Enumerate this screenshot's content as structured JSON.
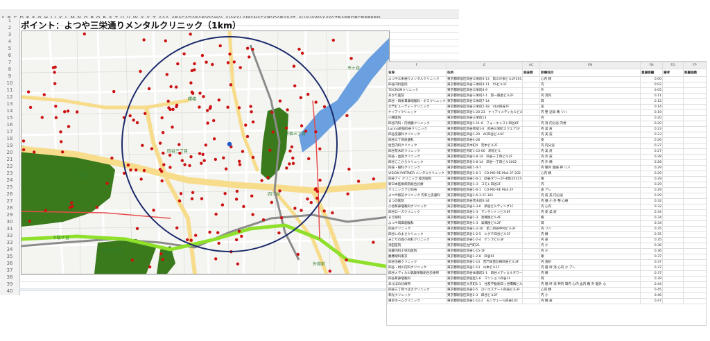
{
  "sheet": {
    "columns": [
      "A",
      "B",
      "C",
      "D",
      "E",
      "F",
      "G",
      "H",
      "I",
      "J",
      "K",
      "L",
      "M",
      "N",
      "O",
      "P",
      "Q",
      "R",
      "S",
      "T",
      "U",
      "V",
      "W",
      "X",
      "Y",
      "Z",
      "AAA",
      "ABACADAEAFAGAHAI",
      "AJAKALAMANACAPAQARASAT",
      "AUAVAWAXAYAZBAEBDBCBEBFBG"
    ],
    "rows": [
      "1",
      "2",
      "3",
      "4",
      "5",
      "6",
      "7",
      "8",
      "9",
      "10",
      "11",
      "12",
      "13",
      "14",
      "15",
      "16",
      "17",
      "18",
      "19",
      "20",
      "21",
      "22",
      "23",
      "24",
      "25",
      "26",
      "27",
      "28",
      "29",
      "30",
      "31",
      "32",
      "33",
      "34",
      "35",
      "36",
      "37",
      "38",
      "39",
      "40"
    ]
  },
  "title": "ポイント：よつや三栄通りメンタルクリニック（1km）",
  "map": {
    "station_labels": [
      "新宿三丁目",
      "四谷三丁目",
      "曙橋",
      "市ヶ谷",
      "四ツ谷",
      "千駄ケ谷",
      "信濃町",
      "国立競技場",
      "外苑前",
      "内藤町"
    ],
    "colors": {
      "park": "#3a7a1c",
      "rail": "#8ee02b",
      "road_major": "#f7dc8c",
      "circle": "#1a2a6b",
      "dot": "#cc1111",
      "water": "#6aa0df"
    }
  },
  "panel": {
    "col_letters": [
      "F",
      "G",
      "AC",
      "FM",
      "FN",
      "FO",
      "FP"
    ],
    "headers": [
      "名称",
      "住所",
      "病床数",
      "診療科目",
      "直線距離",
      "備考",
      "距離指数"
    ],
    "rows": [
      [
        "よつや三栄通りメンタルクリニック",
        "東京都新宿区四谷三栄町4-13　第三冷泉ビル2F201",
        "",
        "心内 精",
        "0.00"
      ],
      [
        "四谷内科医院",
        "東京都新宿区四谷三栄町4-11　YSビル1F",
        "",
        "内",
        "0.02"
      ],
      [
        "TOCROMクリニック",
        "東京都新宿区四谷三栄町4-9",
        "",
        "外",
        "0.05"
      ],
      [
        "あかり医院",
        "東京都新宿区四谷三栄町2-1　第一興産ビル2F",
        "",
        "内 消内",
        "0.11"
      ],
      [
        "四谷・四栄耳鼻咽喉科・ボスクリニック",
        "東京都新宿区四谷三栄町7-14",
        "",
        "耳",
        "0.12"
      ],
      [
        "大門ビューティークリニック",
        "東京都新宿区四谷三栄町2-18　Vbit四谷7F",
        "",
        "美",
        "0.14"
      ],
      [
        "ケイアイクリニック",
        "東京都新宿区四谷1-20-23　ケイアイメディカルビル",
        "",
        "内 整 泌尿 精 リハ",
        "0.19"
      ],
      [
        "小橋医院",
        "東京都新宿区四谷三栄町13",
        "",
        "内",
        "0.20"
      ],
      [
        "四谷内科・内視鏡クリニック",
        "東京都新宿区四谷1-11-6　フォーキャスト四谷6F",
        "",
        "内 消 内分泌 内視",
        "0.20"
      ],
      [
        "Lucina新宿四谷クリニック",
        "東京都新宿区四谷新宿1-6　四谷三栄町スクエア1F",
        "",
        "内 美 皮",
        "0.23"
      ],
      [
        "四谷皮膚科クリニック",
        "東京都新宿区四谷1-20　AC四谷ビル6F",
        "",
        "内 美 皮",
        "0.23"
      ],
      [
        "四谷三丁目皮膚科",
        "東京都新宿区四谷4-28",
        "",
        "皮",
        "0.26"
      ],
      [
        "住吉内科クリニック",
        "東京都新宿区荒木町4　荒木ビル2F",
        "",
        "内 内分泌",
        "0.27"
      ],
      [
        "四谷荒木町クリニック",
        "東京都新宿区舟町1-10-60　新宿ビル",
        "",
        "内 美 皮",
        "0.27"
      ],
      [
        "四谷・血管クリニック",
        "東京都新宿区四谷3-8-14　四谷三丁目ビル2F",
        "",
        "内 外 皮",
        "0.28"
      ],
      [
        "四谷ここからクリニック",
        "東京都新宿区四谷3-8-14　四谷一丁目ビル1002",
        "",
        "内 外 精",
        "0.28"
      ],
      [
        "四谷・眼科クリニック",
        "東京都新宿区舟町1-4-7",
        "",
        "内 整外 産婦 神 リハ",
        "0.29"
      ],
      [
        "VISION PARTNER メンタルクリニック",
        "東京都新宿区四谷1-6-1　CO-MO-RE-Mall 2F-202",
        "",
        "心内 精",
        "0.29"
      ],
      [
        "四谷アイ クリニック 総合眼科",
        "東京都新宿区四谷1-6-1　四谷タワー2F-4階(2F215-8)",
        "",
        "眼",
        "0.29"
      ],
      [
        "新日本医療病院総合診療",
        "東京都新宿区四谷1-3　コモレ四谷2F",
        "",
        "内",
        "0.29"
      ],
      [
        "クリニックアビ四谷",
        "東京都新宿区四谷1-6-1　CO-MO-RE Mall 2F",
        "",
        "皮 アレ",
        "0.29"
      ],
      [
        "よつや駅前クリニック 内科と皮膚科",
        "東京都新宿区四谷1-6-3-1F-101",
        "",
        "内 皮 美 内分泌",
        "0.29"
      ],
      [
        "まつの医院",
        "東京都新宿区四谷荒木町6-34",
        "",
        "内 循 小 外 整 心療",
        "0.32"
      ],
      [
        "小池耳鼻咽喉科クリニック",
        "東京都新宿区四谷3-3-6　新宿ビルディング1F",
        "",
        "内 心内",
        "0.32"
      ],
      [
        "四谷ローズクリニック",
        "東京都新宿区四谷1-3　マンチントンビル6F",
        "",
        "内 皮 美 産",
        "0.34"
      ],
      [
        "まえ眼科",
        "東京都新宿区四谷1-3　高橋屋ビル4F",
        "",
        "眼",
        "0.34"
      ],
      [
        "よつや耳鼻咽喉科",
        "東京都新宿区四谷1-3　高橋屋ビル2F",
        "",
        "耳",
        "0.34"
      ],
      [
        "四谷クリニック",
        "東京都新宿区四谷1-2-30　第二四谷中村ビル3F",
        "",
        "内 リハ",
        "0.35"
      ],
      [
        "四谷いのまさクリニック",
        "東京都新宿区四谷1-2-5　ヒグチ四谷ビル3F",
        "",
        "内 精",
        "0.35"
      ],
      [
        "みどりの森小児科クリニック",
        "東京都新宿区四谷1-2-4　ケンブビル3F",
        "",
        "内 皮",
        "0.35"
      ],
      [
        "須田医院",
        "東京都新宿区左門町21",
        "",
        "内 小",
        "0.36"
      ],
      [
        "佐藤内科小児科医院",
        "東京都新宿区四谷1-15-1F",
        "",
        "内 小",
        "0.36"
      ],
      [
        "慶應眼科東京",
        "東京都新宿区四谷1-2-8　四谷6F",
        "",
        "眼",
        "0.37"
      ],
      [
        "四谷治療クリニック",
        "東京都新宿区四谷1-13　荒門早苗診療四谷ビル3F",
        "",
        "内 透析",
        "0.37"
      ],
      [
        "四谷・村川内科クリニック",
        "東京都新宿区四谷1-13　山本ビル1F",
        "",
        "内 循 呼 消 心内 小 アレ",
        "0.37"
      ],
      [
        "四谷メディカル健康保険組合診療所",
        "東京都新宿区四谷本塩町5-1　四谷メディカルタワー1階",
        "",
        "内 精",
        "0.37"
      ],
      [
        "四谷耳鼻咽喉科",
        "東京都新宿区新宿区1-6　マンション四谷1F",
        "",
        "耳",
        "0.39"
      ],
      [
        "あけぼの診療所",
        "東京都新宿区大京町1-1　住友不動産四ッ谷曙橋ビル3F",
        "",
        "内 循 呼 消 神内 腎内 心内 血内 糖 外 脳外 心",
        "0.44"
      ],
      [
        "四谷三丁目つばさクリニック",
        "東京都新宿区四谷3-5　ひいエステート四谷ビル3F",
        "",
        "心内 精",
        "0.45"
      ],
      [
        "和光クリニック",
        "東京都新宿区四谷2-3　四谷ビル2F",
        "",
        "内 小",
        "0.46"
      ],
      [
        "東京ホームクリニック",
        "東京都新宿区四谷1-12-2　モンヴェール四谷102",
        "",
        "内 精 皮",
        "0.47"
      ]
    ]
  }
}
